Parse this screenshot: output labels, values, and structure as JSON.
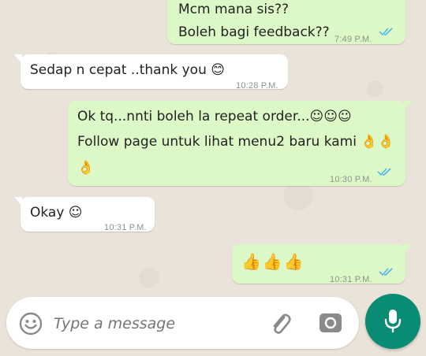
{
  "messages": [
    {
      "direction": "outgoing",
      "lines": [
        "Mcm mana sis??",
        "Boleh bagi feedback??"
      ],
      "time": "7:49 P.M.",
      "status": "read"
    },
    {
      "direction": "incoming",
      "lines": [
        "Sedap n cepat ..thank you 😊"
      ],
      "time": "10:28 P.M."
    },
    {
      "direction": "outgoing",
      "lines": [
        "Ok tq...nnti boleh la repeat order...☺☺☺",
        "Follow page untuk lihat menu2 baru kami 👌👌",
        "👌"
      ],
      "time": "10:30 P.M.",
      "status": "read"
    },
    {
      "direction": "incoming",
      "lines": [
        "Okay ☺"
      ],
      "time": "10:31 P.M."
    },
    {
      "direction": "outgoing",
      "lines": [
        "👍👍👍"
      ],
      "time": "10:31 P.M.",
      "status": "read"
    }
  ],
  "composer": {
    "placeholder": "Type a message",
    "emoji_icon": "smiley-icon",
    "attach_icon": "paperclip-icon",
    "camera_icon": "camera-icon",
    "send_icon": "microphone-icon"
  },
  "colors": {
    "outgoing_bubble": "#dcf8c6",
    "incoming_bubble": "#ffffff",
    "read_ticks": "#4fb6ec",
    "accent": "#0a8b74"
  }
}
